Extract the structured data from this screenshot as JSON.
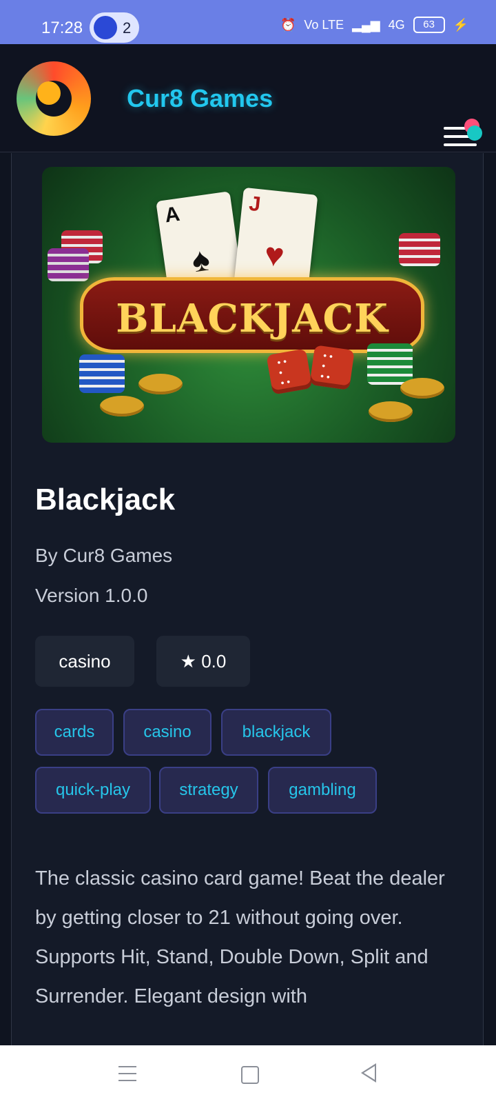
{
  "status": {
    "time": "17:28",
    "notification_count": "2",
    "network": "4G",
    "volte": "Vo LTE",
    "battery": "63"
  },
  "header": {
    "brand": "Cur8 Games"
  },
  "hero": {
    "title": "BLACKJACK",
    "card1_rank": "A",
    "card2_rank": "J"
  },
  "game": {
    "title": "Blackjack",
    "by": "By Cur8 Games",
    "version": "Version 1.0.0",
    "category": "casino",
    "rating": "★ 0.0",
    "tags": [
      "cards",
      "casino",
      "blackjack",
      "quick-play",
      "strategy",
      "gambling"
    ],
    "description": "The classic casino card game! Beat the dealer by getting closer to 21 without going over. Supports Hit, Stand, Double Down, Split and Surrender. Elegant design with"
  },
  "colors": {
    "accent": "#22c7ee",
    "tag_bg": "#27294f",
    "statusbar": "#6a7fe6"
  }
}
